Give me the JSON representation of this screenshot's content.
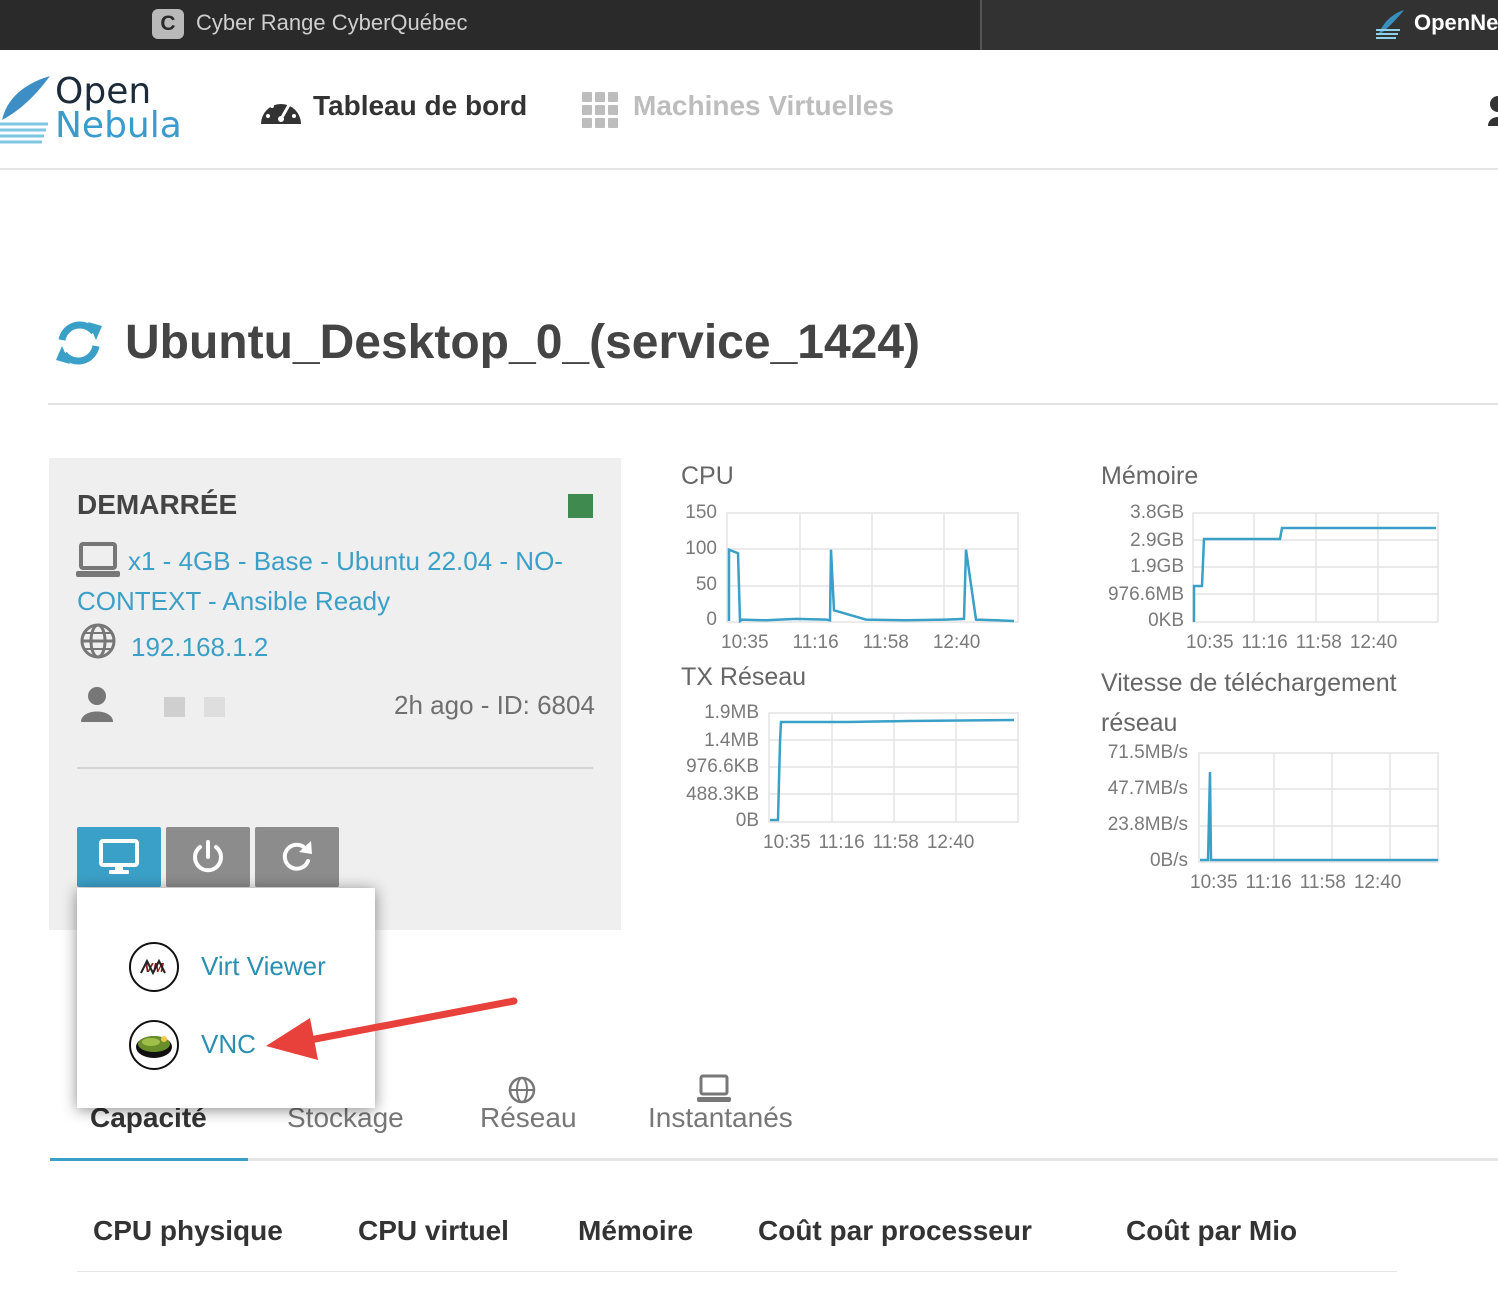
{
  "browser": {
    "tab1_icon_letter": "C",
    "tab1_title": "Cyber Range CyberQuébec",
    "tab2_title": "OpenNe"
  },
  "header": {
    "logo_line1": "Open",
    "logo_line2": "Nebula",
    "nav_dashboard": "Tableau de bord",
    "nav_vms": "Machines Virtuelles"
  },
  "vm": {
    "title": "Ubuntu_Desktop_0_(service_1424)",
    "state": "DEMARRÉE",
    "state_color": "#3f8a4f",
    "template_line1": "x1 - 4GB - Base - Ubuntu 22.04 - NO-",
    "template_line2": "CONTEXT - Ansible Ready",
    "ip": "192.168.1.2",
    "meta": "2h ago - ID: 6804"
  },
  "colors": {
    "accent": "#3ba0c7",
    "button_primary": "#3ba0c7",
    "button_secondary": "#8c8c8c",
    "chart_line": "#3ba0c7",
    "annotation_arrow": "#e8403a"
  },
  "actions": {
    "console_icon": "monitor-icon",
    "power_icon": "power-icon",
    "reboot_icon": "refresh-icon"
  },
  "console_menu": {
    "items": [
      {
        "label": "Virt Viewer",
        "icon": "virt-viewer-icon"
      },
      {
        "label": "VNC",
        "icon": "vnc-icon"
      }
    ]
  },
  "chart_data": [
    {
      "type": "line",
      "title": "CPU",
      "x_ticks": [
        "10:35",
        "11:16",
        "11:58",
        "12:40"
      ],
      "y_ticks": [
        "150",
        "100",
        "50",
        "0"
      ],
      "ylim": [
        0,
        150
      ],
      "grid": true,
      "series": [
        {
          "values": [
            0,
            100,
            95,
            0,
            2,
            1,
            3,
            2,
            1,
            100,
            15,
            2,
            1,
            2,
            3,
            100,
            2,
            1,
            0
          ]
        }
      ]
    },
    {
      "type": "line",
      "title": "Mémoire",
      "x_ticks": [
        "10:35",
        "11:16",
        "11:58",
        "12:40"
      ],
      "y_ticks": [
        "3.8GB",
        "2.9GB",
        "1.9GB",
        "976.6MB",
        "0KB"
      ],
      "grid": true,
      "series": [
        {
          "values_gb": [
            0,
            1.2,
            2.7,
            2.7,
            3.0,
            3.0
          ]
        }
      ]
    },
    {
      "type": "line",
      "title": "TX Réseau",
      "x_ticks": [
        "10:35",
        "11:16",
        "11:58",
        "12:40"
      ],
      "y_ticks": [
        "1.9MB",
        "1.4MB",
        "976.6KB",
        "488.3KB",
        "0B"
      ],
      "grid": true,
      "series": [
        {
          "values_mb": [
            0,
            0,
            1.8,
            1.8,
            1.82,
            1.85
          ]
        }
      ]
    },
    {
      "type": "line",
      "title": "Vitesse de téléchargement réseau",
      "x_ticks": [
        "10:35",
        "11:16",
        "11:58",
        "12:40"
      ],
      "y_ticks": [
        "71.5MB/s",
        "47.7MB/s",
        "23.8MB/s",
        "0B/s"
      ],
      "grid": true,
      "series": [
        {
          "values_mbs": [
            0,
            60,
            0,
            0,
            0
          ]
        }
      ]
    }
  ],
  "tabs": [
    "Capacité",
    "Stockage",
    "Réseau",
    "Instantanés"
  ],
  "capacity_table": {
    "headers": [
      "CPU physique",
      "CPU virtuel",
      "Mémoire",
      "Coût par processeur",
      "Coût par Mio"
    ]
  }
}
